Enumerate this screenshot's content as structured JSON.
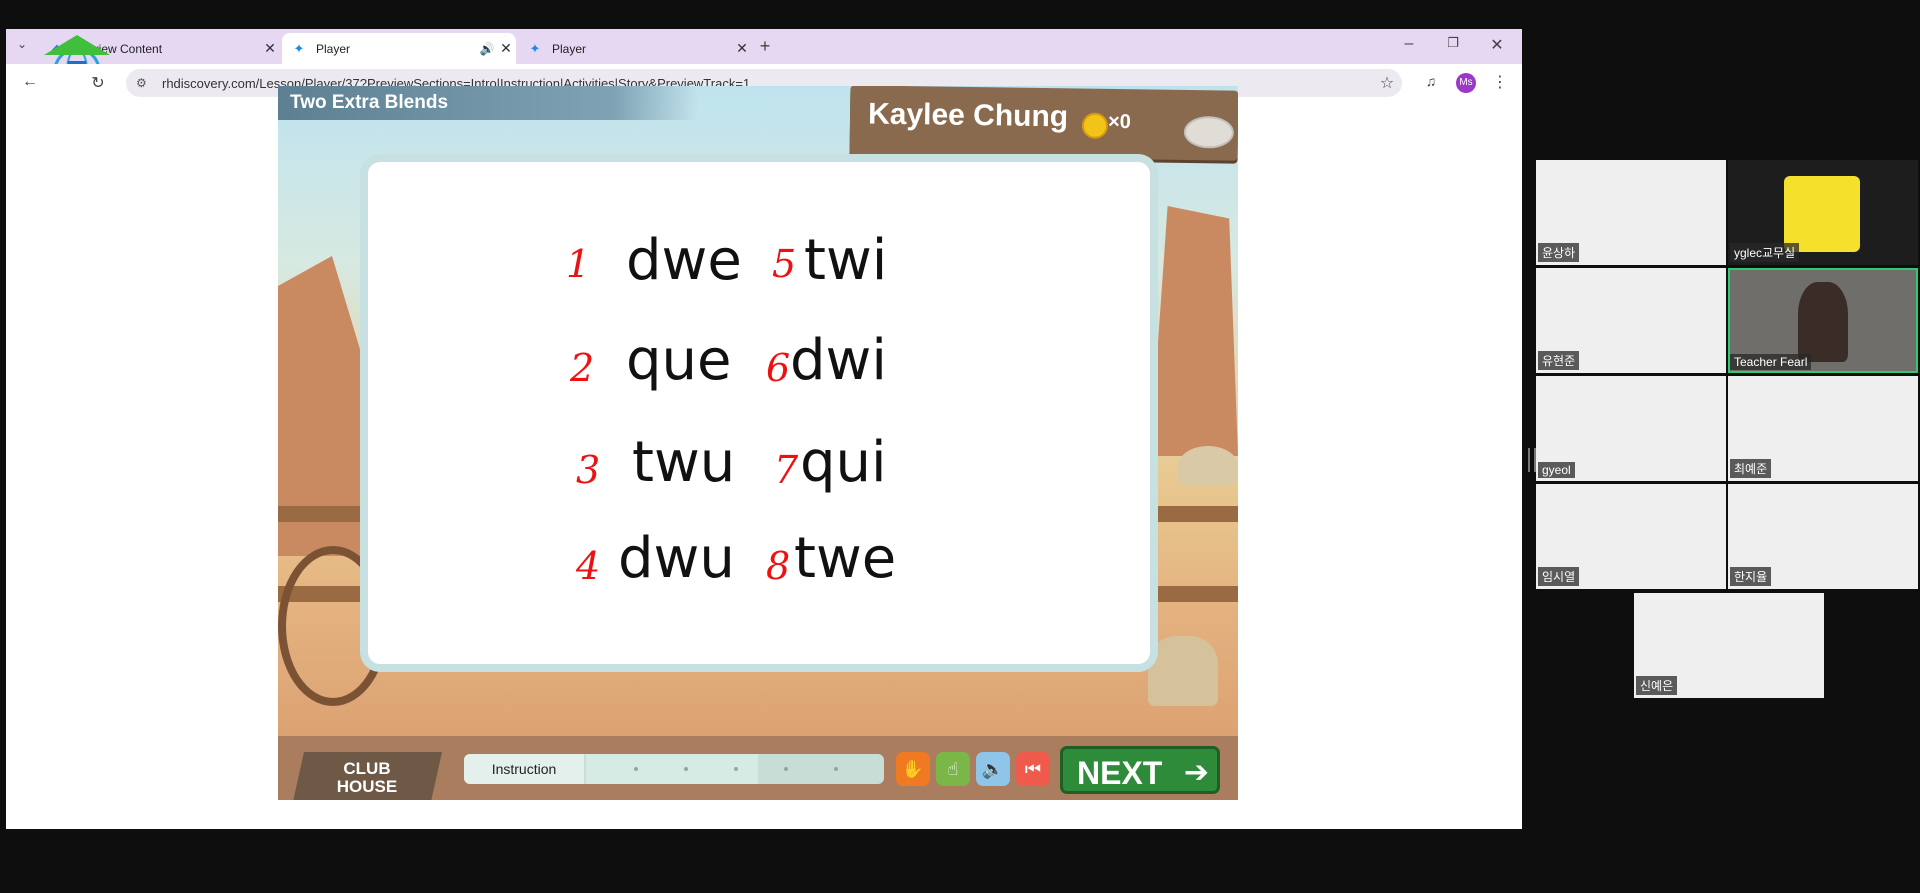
{
  "browser": {
    "tabs": [
      {
        "title": "Preview Content",
        "active": false
      },
      {
        "title": "Player",
        "active": true
      },
      {
        "title": "Player",
        "active": false
      }
    ],
    "url": "rhdiscovery.com/Lesson/Player/37?PreviewSections=Intro|Instruction|Activities|Story&PreviewTrack=1",
    "profile_initials": "Ms"
  },
  "lesson": {
    "title": "Two Extra Blends",
    "student_name": "Kaylee Chung",
    "coins_label": "×0",
    "words": [
      {
        "num": "1",
        "word": "dwe"
      },
      {
        "num": "2",
        "word": "que"
      },
      {
        "num": "3",
        "word": "twu"
      },
      {
        "num": "4",
        "word": "dwu"
      },
      {
        "num": "5",
        "word": "twi"
      },
      {
        "num": "6",
        "word": "dwi"
      },
      {
        "num": "7",
        "word": "qui"
      },
      {
        "num": "8",
        "word": "twe"
      }
    ],
    "club_house_line1": "CLUB",
    "club_house_line2": "HOUSE",
    "section_label": "Instruction",
    "next_label": "NEXT"
  },
  "participants": [
    {
      "name": "윤상하"
    },
    {
      "name": "yglec교무실"
    },
    {
      "name": "유현준"
    },
    {
      "name": "Teacher Fearl"
    },
    {
      "name": "gyeol"
    },
    {
      "name": "최예준"
    },
    {
      "name": "임시열"
    },
    {
      "name": "한지율"
    },
    {
      "name": "신예은"
    }
  ],
  "colors": {
    "tab_strip": "#e6d8f3",
    "next_button": "#2e8b3a",
    "handwritten_numbers": "#e11111",
    "active_speaker_border": "#2ecc71"
  }
}
